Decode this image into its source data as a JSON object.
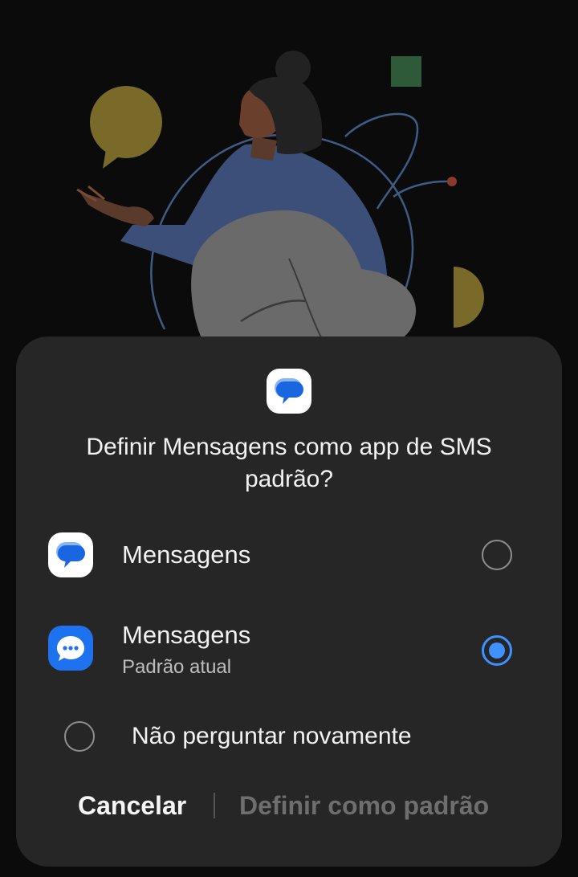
{
  "dialog": {
    "title": "Definir Mensagens como app de SMS padrão?",
    "options": [
      {
        "label": "Mensagens",
        "sublabel": "",
        "icon": "google-messages-icon",
        "selected": false
      },
      {
        "label": "Mensagens",
        "sublabel": "Padrão atual",
        "icon": "samsung-messages-icon",
        "selected": true
      }
    ],
    "dont_ask_label": "Não perguntar novamente",
    "dont_ask_checked": false,
    "cancel_label": "Cancelar",
    "set_default_label": "Definir como padrão"
  },
  "colors": {
    "dialog_background": "#262626",
    "accent": "#3e91ff",
    "google_messages_blue": "#1a66e0",
    "samsung_messages_blue": "#1e72f0",
    "disabled_text": "#6e6e6e"
  }
}
